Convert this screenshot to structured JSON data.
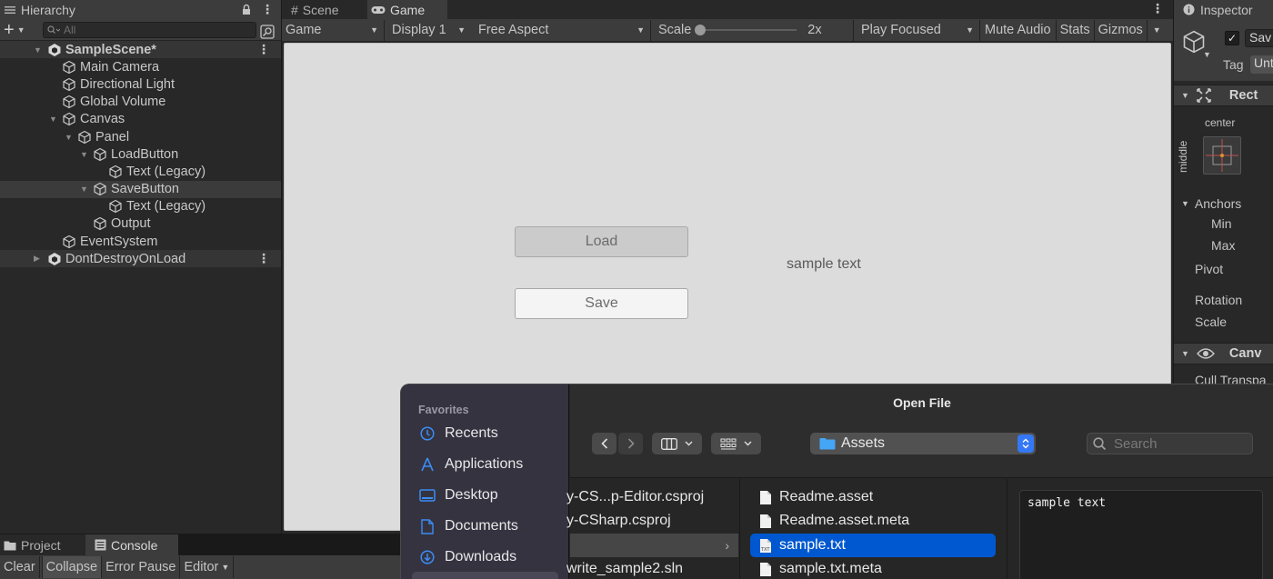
{
  "hierarchy": {
    "tab_label": "Hierarchy",
    "search_placeholder": "All",
    "rows": [
      {
        "label": "SampleScene*",
        "indent": 0
      },
      {
        "label": "Main Camera",
        "indent": 1
      },
      {
        "label": "Directional Light",
        "indent": 1
      },
      {
        "label": "Global Volume",
        "indent": 1
      },
      {
        "label": "Canvas",
        "indent": 1
      },
      {
        "label": "Panel",
        "indent": 2
      },
      {
        "label": "LoadButton",
        "indent": 3
      },
      {
        "label": "Text (Legacy)",
        "indent": 4
      },
      {
        "label": "SaveButton",
        "indent": 3
      },
      {
        "label": "Text (Legacy)",
        "indent": 4
      },
      {
        "label": "Output",
        "indent": 3
      },
      {
        "label": "EventSystem",
        "indent": 1
      },
      {
        "label": "DontDestroyOnLoad",
        "indent": 0
      }
    ]
  },
  "game_view": {
    "tab_scene": "Scene",
    "tab_game": "Game",
    "display_mode": "Game",
    "display": "Display 1",
    "aspect": "Free Aspect",
    "scale_label": "Scale",
    "scale_value": "2x",
    "play_mode": "Play Focused",
    "mute_audio": "Mute Audio",
    "stats": "Stats",
    "gizmos": "Gizmos",
    "load_button": "Load",
    "save_button": "Save",
    "output_text": "sample text"
  },
  "inspector": {
    "tab_label": "Inspector",
    "object_name": "Sav",
    "tag_label": "Tag",
    "tag_value": "Unt",
    "rect_label": "Rect",
    "anchor_h": "center",
    "anchor_v": "middle",
    "anchors_label": "Anchors",
    "min_label": "Min",
    "max_label": "Max",
    "pivot_label": "Pivot",
    "rotation_label": "Rotation",
    "scale_label": "Scale",
    "canvas_label": "Canv",
    "cull_label": "Cull Transpa"
  },
  "bottom": {
    "tab_project": "Project",
    "tab_console": "Console",
    "clear": "Clear",
    "collapse": "Collapse",
    "error_pause": "Error Pause",
    "editor": "Editor"
  },
  "dialog": {
    "title": "Open File",
    "favorites_label": "Favorites",
    "favorites": [
      "Recents",
      "Applications",
      "Desktop",
      "Documents",
      "Downloads"
    ],
    "location": "Assets",
    "search_placeholder": "Search",
    "col1_files": [
      "y-CS...p-Editor.csproj",
      "y-CSharp.csproj",
      "",
      "write_sample2.sln"
    ],
    "col2_files": [
      "Readme.asset",
      "Readme.asset.meta",
      "sample.txt",
      "sample.txt.meta"
    ],
    "preview_text": "sample text"
  }
}
